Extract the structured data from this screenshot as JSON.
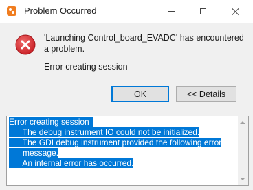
{
  "window": {
    "title": "Problem Occurred"
  },
  "dialog": {
    "message": "'Launching Control_board_EVADC' has encountered a problem.",
    "reason": "Error creating session",
    "ok_label": "OK",
    "details_label": "<< Details"
  },
  "details": {
    "lines": [
      "Error creating session  ",
      "      The debug instrument IO could not be initialized.",
      "      The GDI debug instrument provided the following error",
      "      message.",
      "      An internal error has occurred."
    ]
  },
  "colors": {
    "selection": "#0078d7",
    "error_icon": "#d9262b",
    "app_icon": "#f07d20"
  },
  "icons": {
    "app": "eclipse-app-icon",
    "error": "error-icon"
  }
}
